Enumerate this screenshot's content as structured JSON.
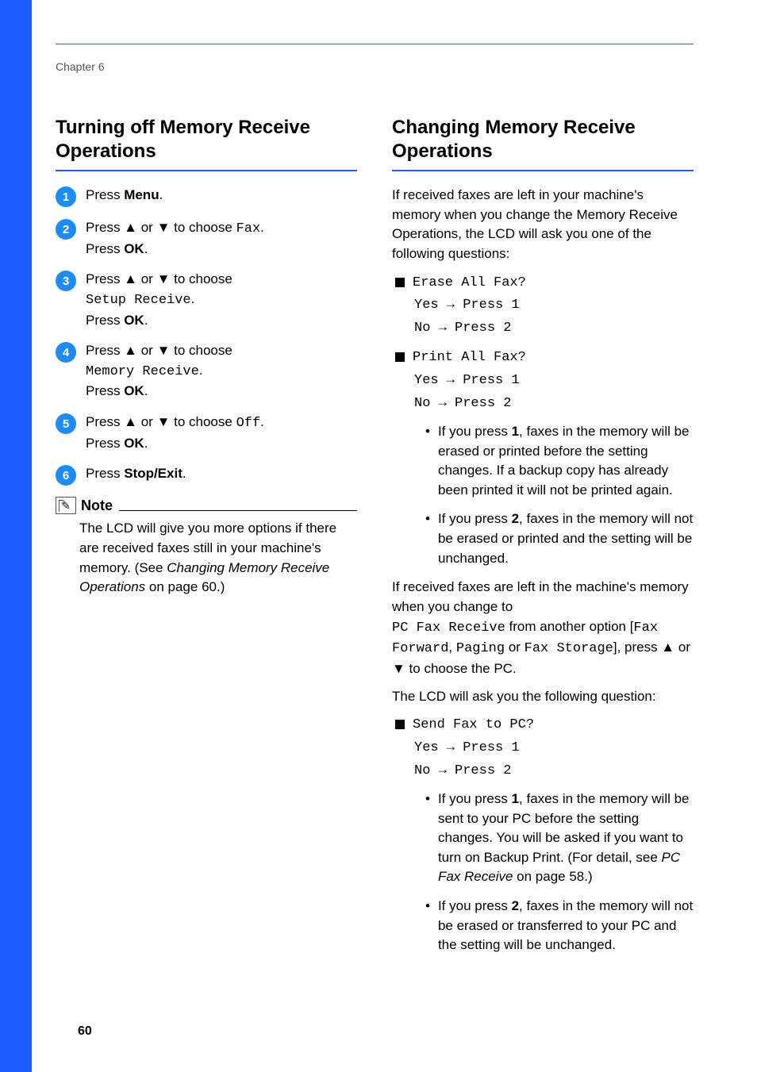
{
  "chapter": "Chapter 6",
  "page_number": "60",
  "left": {
    "heading": "Turning off Memory Receive Operations",
    "steps": {
      "s1": {
        "num": "1",
        "t1": "Press ",
        "b1": "Menu",
        "t2": "."
      },
      "s2": {
        "num": "2",
        "t1": "Press ▲ or ▼ to choose ",
        "m1": "Fax",
        "t2": ".",
        "line2a": "Press ",
        "line2b": "OK",
        "line2c": "."
      },
      "s3": {
        "num": "3",
        "t1": "Press ▲ or ▼ to choose",
        "m1": "Setup Receive",
        "m1b": ".",
        "line2a": "Press ",
        "line2b": "OK",
        "line2c": "."
      },
      "s4": {
        "num": "4",
        "t1": "Press ▲ or ▼ to choose",
        "m1": "Memory Receive",
        "m1b": ".",
        "line2a": "Press ",
        "line2b": "OK",
        "line2c": "."
      },
      "s5": {
        "num": "5",
        "t1": "Press ▲ or ▼ to choose ",
        "m1": "Off",
        "t2": ".",
        "line2a": "Press ",
        "line2b": "OK",
        "line2c": "."
      },
      "s6": {
        "num": "6",
        "t1": "Press ",
        "b1": "Stop/Exit",
        "t2": "."
      }
    },
    "note": {
      "label": "Note",
      "body_a": "The LCD will give you more options if there are received faxes still in your machine's memory. (See ",
      "body_i": "Changing Memory Receive Operations",
      "body_b": " on page 60.)"
    }
  },
  "right": {
    "heading": "Changing Memory Receive Operations",
    "p1": "If received faxes are left in your machine's memory when you change the Memory Receive Operations, the LCD will ask you one of the following questions:",
    "lcd1": {
      "q": "Erase All Fax?",
      "yes": "Yes  → Press 1",
      "no": "No   → Press 2"
    },
    "lcd2": {
      "q": "Print All Fax?",
      "yes": "Yes  → Press 1",
      "no": "No   → Press 2"
    },
    "b1": {
      "pre": "If you press ",
      "key": "1",
      "post": ", faxes in the memory will be erased or printed before the setting changes. If a backup copy has already been printed it will not be printed again."
    },
    "b2": {
      "pre": "If you press ",
      "key": "2",
      "post": ", faxes in the memory will not be erased or printed and the setting will be unchanged."
    },
    "p2a": "If received faxes are left in the machine's memory when you change to ",
    "p2_m1": "PC Fax Receive",
    "p2b": " from another option [",
    "p2_m2": "Fax Forward",
    "p2c": ", ",
    "p2_m3": "Paging",
    "p2d": " or ",
    "p2_m4": "Fax Storage",
    "p2e": "], press ▲ or ▼ to choose the PC.",
    "p3": "The LCD will ask you the following question:",
    "lcd3": {
      "q": "Send Fax to PC?",
      "yes": "Yes  → Press 1",
      "no": "No   → Press 2"
    },
    "b3": {
      "pre": "If you press ",
      "key": "1",
      "post_a": ", faxes in the memory will be sent to your PC before the setting changes. You will be asked if you want to turn on Backup Print. (For detail, see ",
      "ital": "PC Fax Receive",
      "post_b": " on page 58.)"
    },
    "b4": {
      "pre": "If you press ",
      "key": "2",
      "post": ", faxes in the memory will not be erased or transferred to your PC and the setting will be unchanged."
    }
  }
}
